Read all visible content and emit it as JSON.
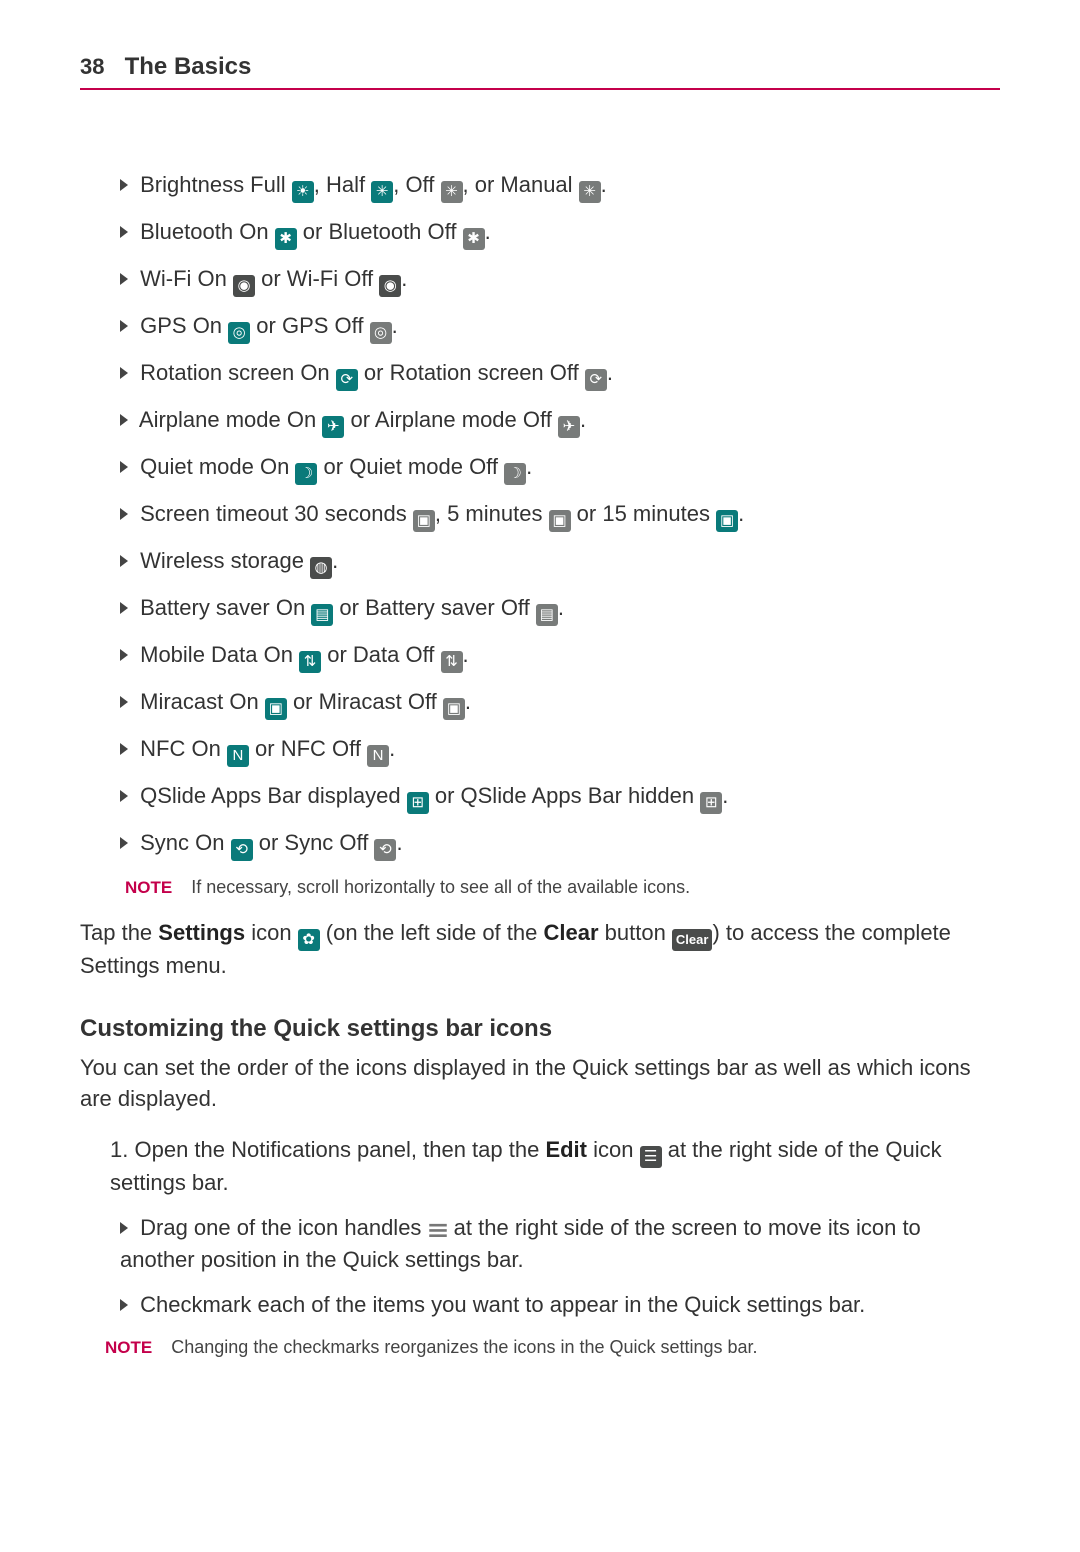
{
  "page_number": "38",
  "chapter": "The Basics",
  "items": {
    "brightness": {
      "t1": "Brightness Full ",
      "t2": ", Half ",
      "t3": ", Off ",
      "t4": ", or Manual ",
      "t5": "."
    },
    "bluetooth": {
      "t1": "Bluetooth On ",
      "t2": " or Bluetooth Off ",
      "t3": "."
    },
    "wifi": {
      "t1": "Wi-Fi On ",
      "t2": " or Wi-Fi Off ",
      "t3": "."
    },
    "gps": {
      "t1": "GPS On ",
      "t2": " or GPS Off ",
      "t3": "."
    },
    "rotation": {
      "t1": "Rotation screen On ",
      "t2": " or Rotation screen Off ",
      "t3": "."
    },
    "airplane": {
      "t1": "Airplane mode On ",
      "t2": " or Airplane mode Off ",
      "t3": "."
    },
    "quiet": {
      "t1": "Quiet mode On ",
      "t2": " or Quiet mode Off ",
      "t3": "."
    },
    "timeout": {
      "t1": "Screen timeout 30 seconds ",
      "t2": ", 5 minutes ",
      "t3": " or 15 minutes ",
      "t4": "."
    },
    "wireless_storage": {
      "t1": "Wireless storage ",
      "t2": "."
    },
    "battery": {
      "t1": "Battery saver On ",
      "t2": " or Battery saver Off ",
      "t3": "."
    },
    "mobile": {
      "t1": "Mobile Data On ",
      "t2": " or Data Off ",
      "t3": "."
    },
    "miracast": {
      "t1": "Miracast On ",
      "t2": " or Miracast Off ",
      "t3": "."
    },
    "nfc": {
      "t1": "NFC On ",
      "t2": " or NFC Off ",
      "t3": "."
    },
    "qslide": {
      "t1": "QSlide Apps Bar displayed ",
      "t2": " or QSlide Apps Bar hidden ",
      "t3": "."
    },
    "sync": {
      "t1": "Sync On ",
      "t2": " or Sync Off ",
      "t3": "."
    }
  },
  "note1_label": "NOTE",
  "note1_text": "If necessary, scroll horizontally to see all of the available icons.",
  "settings_p": {
    "pre": "Tap the ",
    "b1": "Settings",
    "mid1": " icon ",
    "mid2": " (on the left side of the ",
    "b2": "Clear",
    "mid3": " button ",
    "clear_label": "Clear",
    "post": ") to access the complete Settings menu."
  },
  "section_title": "Customizing the Quick settings bar icons",
  "section_p": "You can set the order of the icons displayed in the Quick settings bar as well as which icons are displayed.",
  "step1": {
    "num": "1.",
    "pre": "Open the Notifications panel, then tap the ",
    "b1": "Edit",
    "mid": " icon ",
    "post": " at the right side of the Quick settings bar."
  },
  "sub_a": {
    "pre": "Drag one of the icon handles ",
    "post": " at the right side of the screen to move its icon to another position in the Quick settings bar."
  },
  "sub_b": "Checkmark each of the items you want to appear in the Quick settings bar.",
  "note2_label": "NOTE",
  "note2_text": "Changing the checkmarks reorganizes the icons in the Quick settings bar."
}
